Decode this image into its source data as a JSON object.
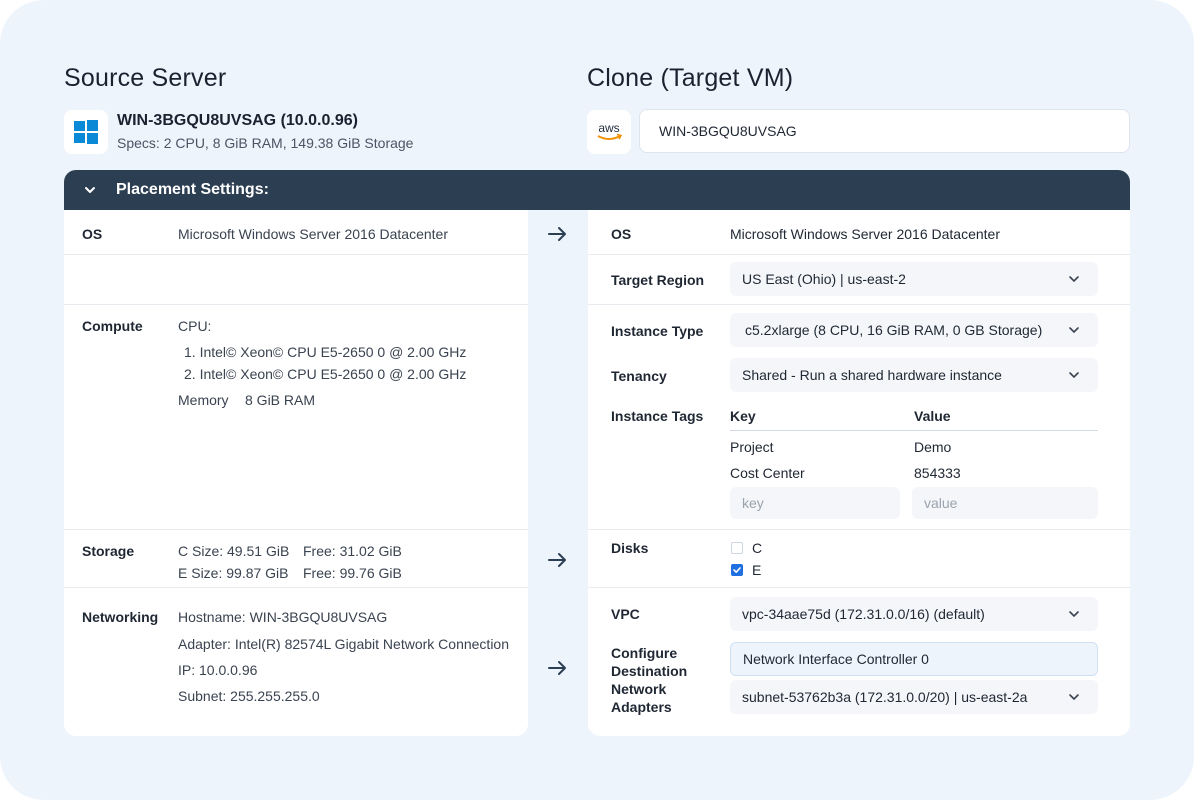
{
  "source": {
    "title": "Source Server",
    "icon": "windows-icon",
    "name": "WIN-3BGQU8UVSAG (10.0.0.96)",
    "specs": "Specs: 2 CPU, 8 GiB RAM, 149.38 GiB Storage",
    "os": {
      "label": "OS",
      "value": "Microsoft Windows Server 2016 Datacenter"
    },
    "compute": {
      "label": "Compute",
      "cpu_label": "CPU:",
      "cpus": [
        "1.  Intel© Xeon© CPU E5-2650 0 @ 2.00 GHz",
        "2.  Intel© Xeon© CPU E5-2650 0 @ 2.00 GHz"
      ],
      "memory_label": "Memory",
      "memory_value": "8 GiB RAM"
    },
    "storage": {
      "label": "Storage",
      "c_size": "C Size: 49.51 GiB",
      "c_free": "Free: 31.02 GiB",
      "e_size": "E Size: 99.87 GiB",
      "e_free": "Free: 99.76 GiB"
    },
    "networking": {
      "label": "Networking",
      "hostname": "Hostname: WIN-3BGQU8UVSAG",
      "adapter": "Adapter: Intel(R) 82574L Gigabit Network Connection",
      "ip": "IP: 10.0.0.96",
      "subnet": "Subnet: 255.255.255.0"
    }
  },
  "target": {
    "title": "Clone (Target VM)",
    "icon": "aws-icon",
    "icon_text": "aws",
    "name_value": "WIN-3BGQU8UVSAG",
    "os": {
      "label": "OS",
      "value": "Microsoft Windows Server 2016 Datacenter"
    },
    "region": {
      "label": "Target Region",
      "value": "US East (Ohio) | us-east-2"
    },
    "instance_type": {
      "label": "Instance Type",
      "value": "c5.2xlarge (8 CPU, 16 GiB RAM, 0 GB Storage)"
    },
    "tenancy": {
      "label": "Tenancy",
      "value": "Shared - Run a shared hardware instance"
    },
    "tags": {
      "label": "Instance Tags",
      "key_header": "Key",
      "value_header": "Value",
      "rows": [
        {
          "key": "Project",
          "value": "Demo"
        },
        {
          "key": "Cost Center",
          "value": "854333"
        }
      ],
      "key_placeholder": "key",
      "value_placeholder": "value"
    },
    "disks": {
      "label": "Disks",
      "items": [
        {
          "name": "C",
          "checked": false
        },
        {
          "name": "E",
          "checked": true
        }
      ]
    },
    "vpc": {
      "label": "VPC",
      "value": "vpc-34aae75d (172.31.0.0/16) (default)"
    },
    "adapters": {
      "label_lines": [
        "Configure",
        "Destination",
        "Network",
        "Adapters"
      ],
      "nic": "Network Interface Controller 0",
      "subnet": "subnet-53762b3a (172.31.0.0/20) | us-east-2a"
    }
  },
  "placement": {
    "label": "Placement Settings:"
  },
  "colors": {
    "header_bar": "#2c3e52",
    "frame_background": "#edf4fc",
    "checkbox_checked": "#1f6fe0",
    "windows_blue": "#0a8ad6",
    "aws_orange": "#f29100"
  }
}
